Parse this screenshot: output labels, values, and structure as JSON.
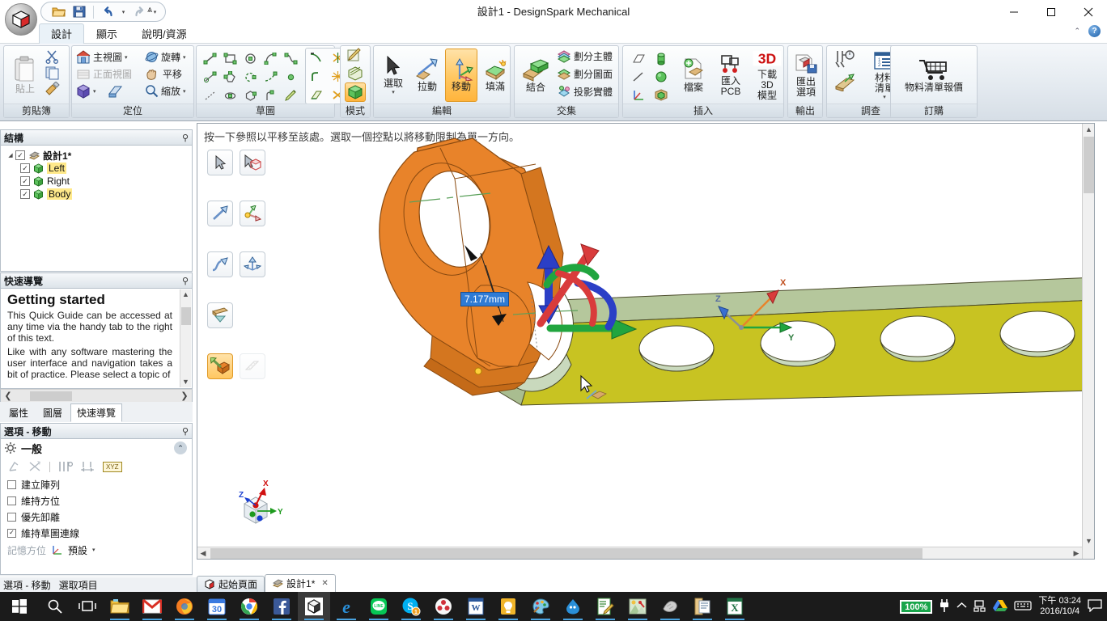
{
  "window": {
    "title": "設計1 - DesignSpark Mechanical",
    "minimize": "—",
    "maximize": "▢",
    "close": "✕"
  },
  "quick_access": {
    "open_icon": "open-folder-icon",
    "save_icon": "save-icon",
    "undo_icon": "undo-icon",
    "redo_icon": "redo-icon",
    "more_icon": "overflow-caret-icon",
    "caret": "▾"
  },
  "ribbon_tabs": [
    {
      "label": "設計",
      "active": true
    },
    {
      "label": "顯示",
      "active": false
    },
    {
      "label": "說明/資源",
      "active": false
    }
  ],
  "ribbon_right": {
    "collapse_icon": "collapse-ribbon-icon",
    "help_label": "?"
  },
  "ribbon": {
    "groups": [
      {
        "name": "clipboard",
        "title": "剪貼簿",
        "paste_label": "貼上",
        "items": [
          "剪下",
          "複製",
          "複製格式"
        ]
      },
      {
        "name": "orient",
        "title": "定位",
        "items": [
          {
            "label": "主視圖",
            "caret": "▾",
            "disabled": false
          },
          {
            "label": "旋轉",
            "caret": "▾",
            "disabled": false
          },
          {
            "label": "正面視圖",
            "caret": "",
            "disabled": true
          },
          {
            "label": "平移",
            "caret": "",
            "disabled": false
          },
          {
            "label": "",
            "caret": "▾",
            "disabled": false
          },
          {
            "label": "縮放",
            "caret": "▾",
            "disabled": false
          }
        ]
      },
      {
        "name": "sketch",
        "title": "草圖"
      },
      {
        "name": "mode",
        "title": "模式"
      },
      {
        "name": "edit",
        "title": "編輯",
        "buttons": [
          {
            "label": "選取",
            "caret": "▾",
            "selected": false
          },
          {
            "label": "拉動",
            "caret": "",
            "selected": false
          },
          {
            "label": "移動",
            "caret": "",
            "selected": true
          },
          {
            "label": "填滿",
            "caret": "",
            "selected": false
          }
        ]
      },
      {
        "name": "intersect",
        "title": "交集",
        "combine_label": "結合",
        "items": [
          "劃分主體",
          "劃分圖面",
          "投影實體"
        ]
      },
      {
        "name": "insert",
        "title": "插入",
        "buttons": [
          {
            "label": "檔案"
          },
          {
            "label": "匯入\nPCB"
          },
          {
            "label": "下載 3D\n模型"
          }
        ]
      },
      {
        "name": "output",
        "title": "輸出",
        "buttons": [
          {
            "label": "匯出\n選項",
            "caret": "▾"
          }
        ]
      },
      {
        "name": "survey",
        "title": "調查",
        "buttons": [
          {
            "label": "材料\n清單",
            "caret": "▾"
          }
        ]
      },
      {
        "name": "order",
        "title": "訂購",
        "buttons": [
          {
            "label": "物料清單報價"
          }
        ]
      }
    ]
  },
  "structure_panel": {
    "title": "結構",
    "pin_icon": "pin-icon",
    "tree": [
      {
        "label": "設計1*",
        "level": 0,
        "checked": true,
        "highlight": false,
        "bold": true,
        "icon": "design-icon"
      },
      {
        "label": "Left",
        "level": 1,
        "checked": true,
        "highlight": true,
        "bold": false,
        "icon": "solid-icon"
      },
      {
        "label": "Right",
        "level": 1,
        "checked": true,
        "highlight": false,
        "bold": false,
        "icon": "solid-icon"
      },
      {
        "label": "Body",
        "level": 1,
        "checked": true,
        "highlight": true,
        "bold": false,
        "icon": "solid-icon"
      }
    ]
  },
  "quick_guide_panel": {
    "title": "快速導覽",
    "pin_icon": "pin-icon",
    "heading": "Getting started",
    "paragraph1": "This Quick Guide can be accessed at any time via the handy tab to the right of this text.",
    "paragraph2": "Like with any software mastering the user interface and navigation takes a bit of practice. Please select a topic of",
    "scroll_up": "▲",
    "scroll_down": "▼",
    "scroll_left": "❮",
    "scroll_right": "❯",
    "tabs": [
      {
        "label": "屬性",
        "active": false
      },
      {
        "label": "圖層",
        "active": false
      },
      {
        "label": "快速導覽",
        "active": true
      }
    ]
  },
  "options_panel": {
    "title": "選項 - 移動",
    "pin_icon": "pin-icon",
    "group_label": "一般",
    "gear_icon": "gear-icon",
    "collapse_icon": "chevron-up-icon",
    "tool_icons": [
      "anchor-icon",
      "detach-icon",
      "ruler-icon",
      "measure-icon",
      "xyz-icon"
    ],
    "checkboxes": [
      {
        "label": "建立陣列",
        "checked": false
      },
      {
        "label": "維持方位",
        "checked": false
      },
      {
        "label": "優先卸離",
        "checked": false
      },
      {
        "label": "維持草圖連線",
        "checked": true
      }
    ],
    "memory_label": "記憶方位",
    "memory_value": "預設",
    "memory_caret": "▾",
    "tabs": [
      {
        "label": "選項 - 移動",
        "active": true
      },
      {
        "label": "選取項目",
        "active": false
      }
    ]
  },
  "viewport": {
    "hint": "按一下參照以平移至該處。選取一個控點以將移動限制為單一方向。",
    "dimension_label": "7.177mm",
    "palette": [
      {
        "name": "select-tool",
        "row": 0,
        "col": 0,
        "selected": false,
        "disabled": false
      },
      {
        "name": "select-solid-tool",
        "row": 0,
        "col": 1,
        "selected": false,
        "disabled": false
      },
      {
        "name": "move-arrow-tool",
        "row": 1,
        "col": 0,
        "selected": false,
        "disabled": false
      },
      {
        "name": "move-handle-tool",
        "row": 1,
        "col": 1,
        "selected": false,
        "disabled": false
      },
      {
        "name": "sweep-tool",
        "row": 2,
        "col": 0,
        "selected": false,
        "disabled": false
      },
      {
        "name": "scale-tool",
        "row": 2,
        "col": 1,
        "selected": false,
        "disabled": false
      },
      {
        "name": "anchor-plane-tool",
        "row": 3,
        "col": 0,
        "selected": false,
        "disabled": false
      },
      {
        "name": "detach-move-tool",
        "row": 4,
        "col": 0,
        "selected": true,
        "disabled": false
      },
      {
        "name": "ruler-tool",
        "row": 4,
        "col": 1,
        "selected": false,
        "disabled": true
      }
    ],
    "axis_triad_model": {
      "x": "X",
      "y": "Y",
      "z": "Z"
    },
    "axis_triad_corner": {
      "x": "X",
      "y": "Y",
      "z": "Z"
    },
    "colors": {
      "orange_part": "#E8832A",
      "yellow_part": "#C8C322",
      "green_face": "#A9C396",
      "gizmo_red": "#D93B3B",
      "gizmo_green": "#21A53F",
      "gizmo_blue": "#2B3FC6",
      "dim_box": "#2F7BD4"
    }
  },
  "doc_tabs": [
    {
      "label": "起始頁面",
      "active": false,
      "closable": false,
      "icon": "home-cube-icon"
    },
    {
      "label": "設計1*",
      "active": true,
      "closable": true,
      "icon": "design-icon"
    }
  ],
  "status_bar": {
    "items": [
      "選項 - 移動",
      "選取項目"
    ]
  },
  "taskbar": {
    "start_icon": "windows-start-icon",
    "search_icon": "search-icon",
    "taskview_icon": "task-view-icon",
    "apps": [
      {
        "name": "file-explorer-icon",
        "running": true,
        "active": false
      },
      {
        "name": "gmail-icon",
        "running": true,
        "active": false
      },
      {
        "name": "firefox-icon",
        "running": true,
        "active": false
      },
      {
        "name": "google-calendar-icon",
        "running": true,
        "active": false,
        "badge": "30"
      },
      {
        "name": "google-chrome-icon",
        "running": true,
        "active": false
      },
      {
        "name": "facebook-icon",
        "running": true,
        "active": false
      },
      {
        "name": "designspark-icon",
        "running": true,
        "active": true
      },
      {
        "name": "internet-explorer-icon",
        "running": true,
        "active": false
      },
      {
        "name": "line-icon",
        "running": true,
        "active": false
      },
      {
        "name": "skype-icon",
        "running": true,
        "active": false,
        "badge": "1"
      },
      {
        "name": "flower-app-icon",
        "running": true,
        "active": false
      },
      {
        "name": "word-icon",
        "running": true,
        "active": false
      },
      {
        "name": "lightbulb-icon",
        "running": true,
        "active": false
      },
      {
        "name": "paint-palette-icon",
        "running": true,
        "active": false
      },
      {
        "name": "blue-drop-icon",
        "running": true,
        "active": false
      },
      {
        "name": "notepad-edit-icon",
        "running": true,
        "active": false
      },
      {
        "name": "photos-icon",
        "running": true,
        "active": false
      },
      {
        "name": "grey-app-icon",
        "running": true,
        "active": false
      },
      {
        "name": "document-icon",
        "running": true,
        "active": false
      },
      {
        "name": "excel-icon",
        "running": true,
        "active": false
      }
    ],
    "tray": {
      "battery_label": "100%",
      "plug_icon": "power-plug-icon",
      "chevron_icon": "show-hidden-icons-icon",
      "network_icon": "network-icon",
      "drive_icon": "google-drive-icon",
      "keyboard_icon": "keyboard-icon",
      "notification_icon": "action-center-icon"
    },
    "clock": {
      "time": "下午 03:24",
      "date": "2016/10/4"
    }
  }
}
